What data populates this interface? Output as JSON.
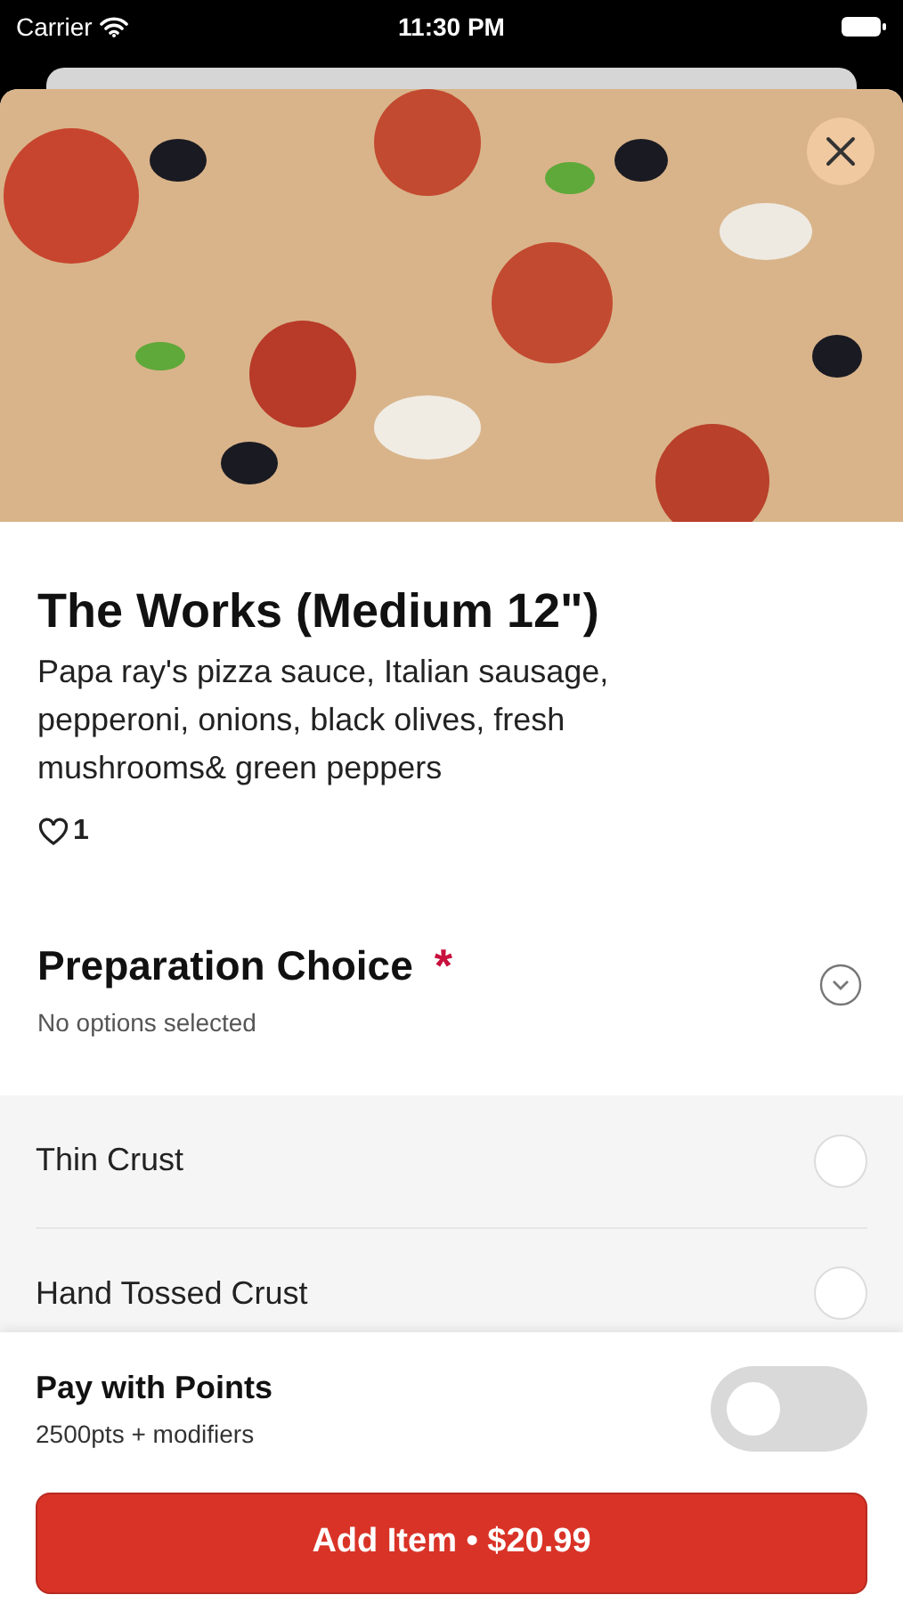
{
  "status_bar": {
    "carrier": "Carrier",
    "time": "11:30 PM"
  },
  "item": {
    "title": "The Works (Medium 12\")",
    "description": "Papa ray's pizza sauce, Italian sausage, pepperoni, onions, black olives, fresh mushrooms& green peppers",
    "likes": "1",
    "liked": false
  },
  "section": {
    "title": "Preparation Choice",
    "required": true,
    "required_mark": "*",
    "subtitle": "No options selected",
    "expanded": true
  },
  "options": [
    {
      "label": "Thin Crust",
      "selected": false
    },
    {
      "label": "Hand Tossed Crust",
      "selected": false
    }
  ],
  "points": {
    "title": "Pay with Points",
    "subtitle": "2500pts + modifiers",
    "on": false
  },
  "add_button": {
    "label": "Add Item • $20.99"
  }
}
